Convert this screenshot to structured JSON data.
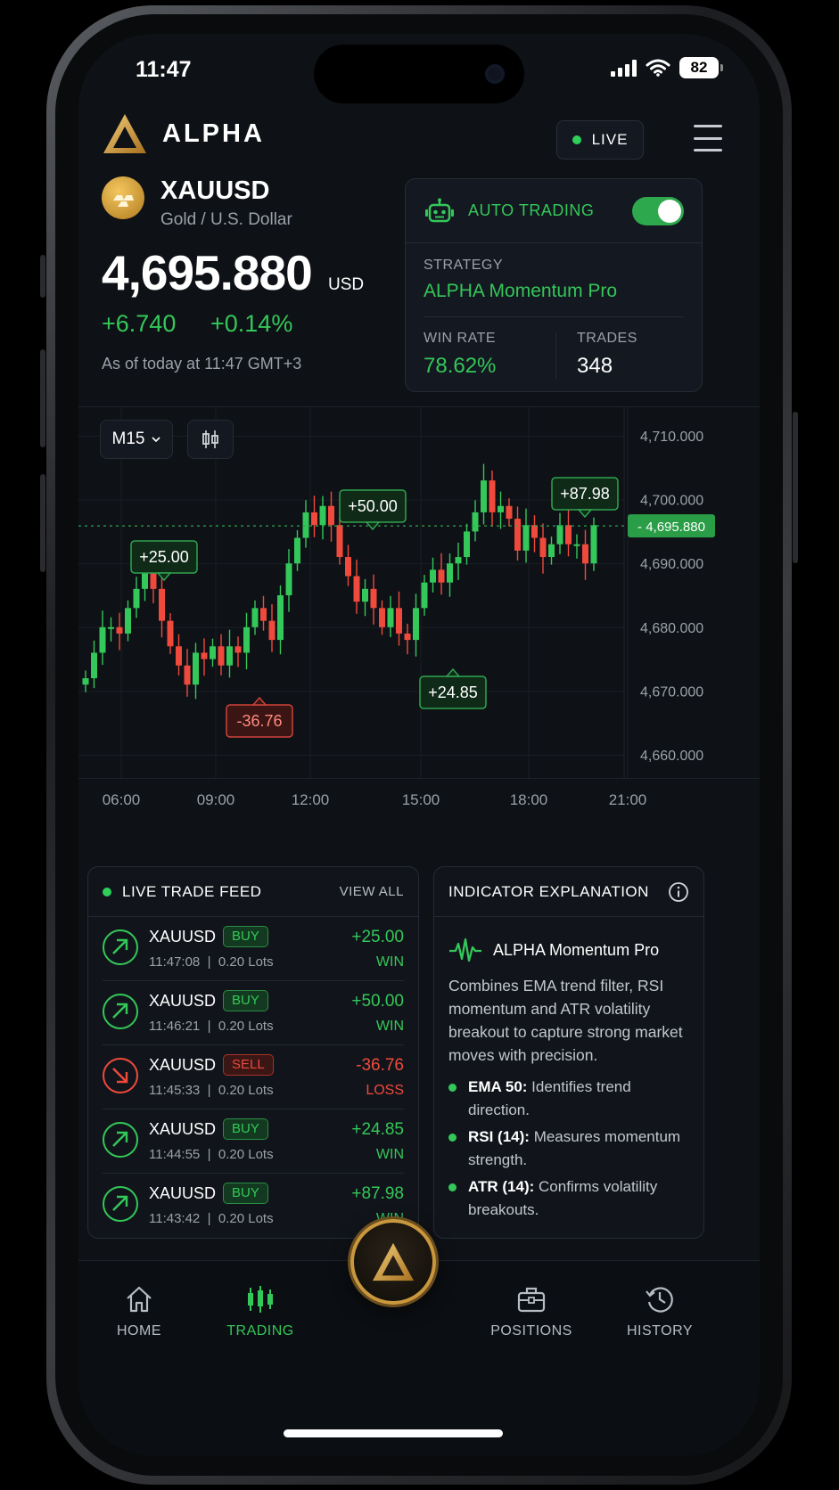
{
  "status": {
    "time": "11:47",
    "battery": "82"
  },
  "header": {
    "brand": "ALPHA",
    "live_label": "LIVE"
  },
  "symbol": {
    "code": "XAUUSD",
    "name": "Gold / U.S. Dollar",
    "price": "4,695.880",
    "unit": "USD",
    "change": "+6.740",
    "change_pct": "+0.14%",
    "as_of": "As of today at 11:47 GMT+3"
  },
  "auto_trading": {
    "label": "AUTO TRADING",
    "enabled": true,
    "strategy_label": "STRATEGY",
    "strategy": "ALPHA Momentum Pro",
    "win_rate_label": "WIN RATE",
    "win_rate": "78.62%",
    "trades_label": "TRADES",
    "trades": "348"
  },
  "chart_controls": {
    "timeframe": "M15"
  },
  "chart_data": {
    "type": "candlestick",
    "y_ticks": [
      "4,710.000",
      "4,700.000",
      "4,690.000",
      "4,680.000",
      "4,670.000",
      "4,660.000"
    ],
    "y_tick_values": [
      4710,
      4700,
      4690,
      4680,
      4670,
      4660
    ],
    "x_ticks": [
      "06:00",
      "09:00",
      "12:00",
      "15:00",
      "18:00",
      "21:00"
    ],
    "current_price_label": "4,695.880",
    "current_price": 4695.88,
    "close_path": [
      4672,
      4676,
      4680,
      4680,
      4679,
      4683,
      4686,
      4689,
      4686,
      4681,
      4677,
      4674,
      4671,
      4676,
      4675,
      4677,
      4674,
      4677,
      4676,
      4680,
      4683,
      4681,
      4678,
      4685,
      4690,
      4694,
      4698,
      4696,
      4699,
      4696,
      4691,
      4688,
      4684,
      4686,
      4683,
      4680,
      4683,
      4679,
      4678,
      4683,
      4687,
      4689,
      4687,
      4690,
      4691,
      4695,
      4698,
      4703,
      4698,
      4699,
      4697,
      4692,
      4696,
      4694,
      4691,
      4693,
      4696,
      4693,
      4693,
      4690,
      4696
    ],
    "annotations": [
      {
        "label": "+25.00",
        "type": "win"
      },
      {
        "label": "-36.76",
        "type": "loss"
      },
      {
        "label": "+50.00",
        "type": "win"
      },
      {
        "label": "+24.85",
        "type": "win"
      },
      {
        "label": "+87.98",
        "type": "win"
      }
    ]
  },
  "feed": {
    "title": "LIVE TRADE FEED",
    "view_all": "VIEW ALL",
    "trades": [
      {
        "symbol": "XAUUSD",
        "side": "BUY",
        "time": "11:47:08",
        "lots": "0.20 Lots",
        "pnl": "+25.00",
        "result": "WIN"
      },
      {
        "symbol": "XAUUSD",
        "side": "BUY",
        "time": "11:46:21",
        "lots": "0.20 Lots",
        "pnl": "+50.00",
        "result": "WIN"
      },
      {
        "symbol": "XAUUSD",
        "side": "SELL",
        "time": "11:45:33",
        "lots": "0.20 Lots",
        "pnl": "-36.76",
        "result": "LOSS"
      },
      {
        "symbol": "XAUUSD",
        "side": "BUY",
        "time": "11:44:55",
        "lots": "0.20 Lots",
        "pnl": "+24.85",
        "result": "WIN"
      },
      {
        "symbol": "XAUUSD",
        "side": "BUY",
        "time": "11:43:42",
        "lots": "0.20 Lots",
        "pnl": "+87.98",
        "result": "WIN"
      }
    ]
  },
  "indicator": {
    "title": "INDICATOR EXPLANATION",
    "name": "ALPHA Momentum Pro",
    "description": "Combines EMA trend filter, RSI momentum and ATR volatility breakout to capture strong market moves with precision.",
    "points": [
      {
        "key": "EMA 50:",
        "text": " Identifies trend direction."
      },
      {
        "key": "RSI (14):",
        "text": " Measures momentum strength."
      },
      {
        "key": "ATR (14):",
        "text": " Confirms volatility breakouts."
      }
    ]
  },
  "nav": {
    "home": "HOME",
    "trading": "TRADING",
    "positions": "POSITIONS",
    "history": "HISTORY"
  },
  "colors": {
    "up": "#34c759",
    "down": "#ef4a3c",
    "gold": "#c9973e",
    "bg": "#0e1116"
  }
}
